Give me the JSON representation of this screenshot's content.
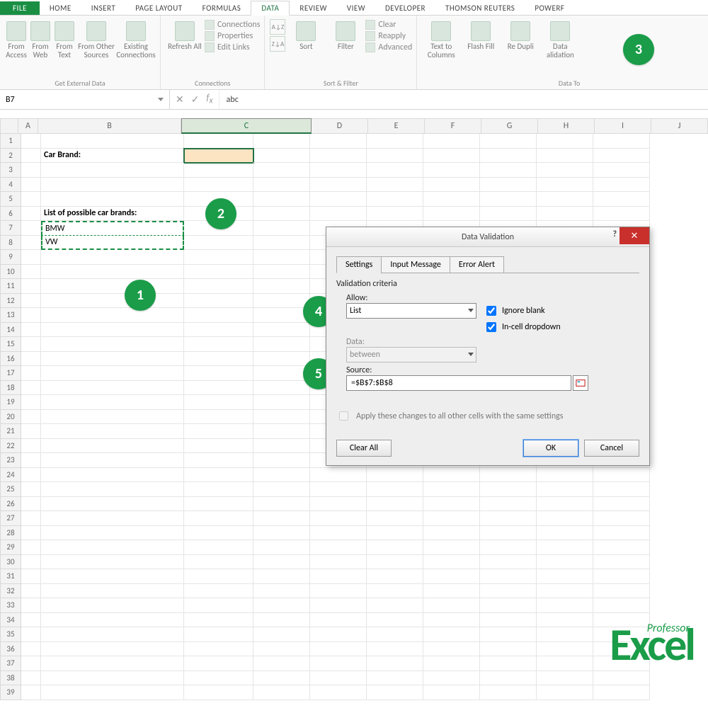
{
  "tabs": {
    "file": "FILE",
    "home": "HOME",
    "insert": "INSERT",
    "page_layout": "PAGE LAYOUT",
    "formulas": "FORMULAS",
    "data": "DATA",
    "review": "REVIEW",
    "view": "VIEW",
    "developer": "DEVELOPER",
    "thomson": "THOMSON REUTERS",
    "powerp": "POWERF"
  },
  "ribbon": {
    "get_external": {
      "title": "Get External Data",
      "from_access": "From Access",
      "from_web": "From Web",
      "from_text": "From Text",
      "from_other": "From Other Sources",
      "existing": "Existing Connections"
    },
    "connections": {
      "title": "Connections",
      "refresh": "Refresh All",
      "connections": "Connections",
      "properties": "Properties",
      "edit_links": "Edit Links"
    },
    "sort_filter": {
      "title": "Sort & Filter",
      "sort": "Sort",
      "filter": "Filter",
      "clear": "Clear",
      "reapply": "Reapply",
      "advanced": "Advanced"
    },
    "data_tools": {
      "title": "Data To",
      "text_to_columns": "Text to Columns",
      "flash_fill": "Flash Fill",
      "remove_dup": "Re Dupli",
      "data_validation": "Data alidation"
    }
  },
  "namebox": "B7",
  "formula_value": "abc",
  "columns": [
    "A",
    "B",
    "C",
    "D",
    "E",
    "F",
    "G",
    "H",
    "I",
    "J"
  ],
  "rows_count": 39,
  "cells": {
    "B2": "Car Brand:",
    "B6": "List of possible car brands:",
    "B7": "BMW",
    "B8": "VW"
  },
  "dialog": {
    "title": "Data Validation",
    "tabs": {
      "settings": "Settings",
      "input": "Input Message",
      "error": "Error Alert"
    },
    "criteria_label": "Validation criteria",
    "allow_label": "Allow:",
    "allow_value": "List",
    "data_label": "Data:",
    "data_value": "between",
    "source_label": "Source:",
    "source_value": "=$B$7:$B$8",
    "ignore_blank": "Ignore blank",
    "incell_dd": "In-cell dropdown",
    "apply_all": "Apply these changes to all other cells with the same settings",
    "clear_all": "Clear All",
    "ok": "OK",
    "cancel": "Cancel"
  },
  "badges": {
    "1": "1",
    "2": "2",
    "3": "3",
    "4": "4",
    "5": "5"
  },
  "watermark": {
    "prof": "Professor",
    "excel": "Excel"
  }
}
